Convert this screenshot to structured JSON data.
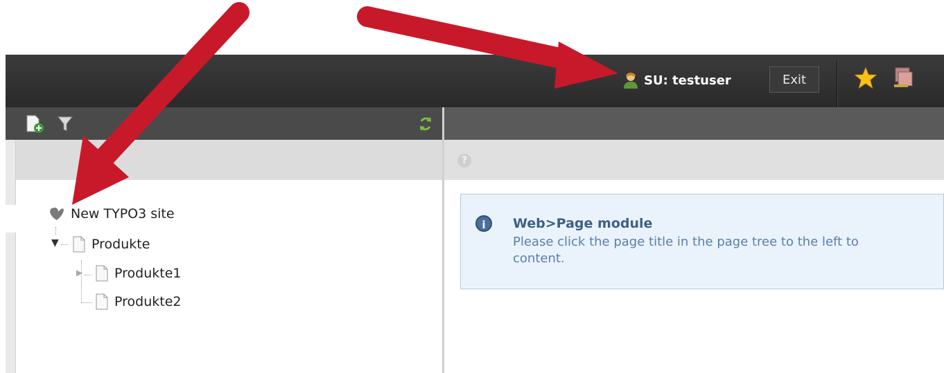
{
  "topbar": {
    "user_label": "SU: testuser",
    "exit_label": "Exit"
  },
  "tree": {
    "root": "New TYPO3 site",
    "items": [
      {
        "label": "Produkte"
      },
      {
        "label": "Produkte1"
      },
      {
        "label": "Produkte2"
      }
    ]
  },
  "info": {
    "title": "Web>Page module",
    "text": "Please click the page title in the page tree to the left to\ncontent."
  },
  "help_glyph": "?",
  "info_glyph": "i",
  "colors": {
    "arrow": "#c8192b",
    "topbar": "#2e2e2e",
    "info_bg": "#eaf3fb"
  }
}
